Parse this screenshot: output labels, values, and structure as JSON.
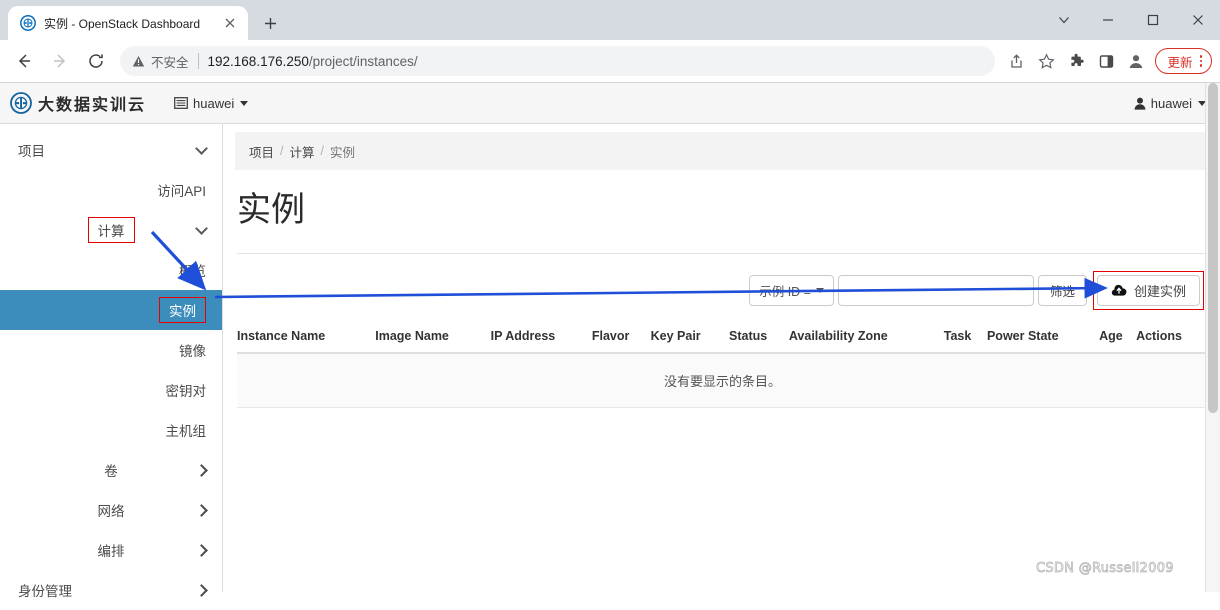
{
  "browser": {
    "tab": {
      "title": "实例 - OpenStack Dashboard",
      "favicon_name": "openstack-favicon",
      "close_label": "✕"
    },
    "newtab_label": "+",
    "window_controls": {
      "tab_search": "⌄",
      "minimize": "—",
      "maximize": "□",
      "close": "✕"
    },
    "nav": {
      "back": "←",
      "forward": "→",
      "reload": "⟳"
    },
    "omnibox": {
      "security_label": "不安全",
      "url_host": "192.168.176.250",
      "url_path": "/project/instances/",
      "url_full": "192.168.176.250/project/instances/"
    },
    "toolbar_icons": [
      {
        "name": "share-icon",
        "glyph": "⤴"
      },
      {
        "name": "bookmark-star-icon",
        "glyph": "☆"
      },
      {
        "name": "extensions-puzzle-icon",
        "glyph": "🧩"
      },
      {
        "name": "side-panel-icon",
        "glyph": "▢"
      },
      {
        "name": "profile-avatar-icon",
        "glyph": "●"
      }
    ],
    "update_button": {
      "label": "更新",
      "color": "#d93025"
    }
  },
  "app": {
    "brand": {
      "name": "大数据实训云",
      "logo_name": "openstack-logo"
    },
    "project_selector": {
      "label": "huawei",
      "icon_name": "project-grid-icon"
    },
    "user_menu": {
      "label": "huawei",
      "icon_name": "user-icon"
    },
    "sidebar": {
      "items": [
        {
          "label": "项目",
          "level": "top",
          "chevron": "down",
          "active": false
        },
        {
          "label": "访问API",
          "level": "sub",
          "chevron": "none",
          "active": false
        },
        {
          "label": "计算",
          "level": "group",
          "chevron": "down",
          "active": false,
          "annotated": true
        },
        {
          "label": "概览",
          "level": "sub",
          "chevron": "none",
          "active": false
        },
        {
          "label": "实例",
          "level": "sub",
          "chevron": "none",
          "active": true,
          "annotated": true
        },
        {
          "label": "镜像",
          "level": "sub",
          "chevron": "none",
          "active": false
        },
        {
          "label": "密钥对",
          "level": "sub",
          "chevron": "none",
          "active": false
        },
        {
          "label": "主机组",
          "level": "sub",
          "chevron": "none",
          "active": false
        },
        {
          "label": "卷",
          "level": "group",
          "chevron": "right",
          "active": false
        },
        {
          "label": "网络",
          "level": "group",
          "chevron": "right",
          "active": false
        },
        {
          "label": "编排",
          "level": "group",
          "chevron": "right",
          "active": false
        },
        {
          "label": "身份管理",
          "level": "top",
          "chevron": "right",
          "active": false
        }
      ]
    },
    "breadcrumb": {
      "items": [
        "项目",
        "计算",
        "实例"
      ],
      "separator": "/"
    },
    "page_title": "实例",
    "table_toolbar": {
      "filter_field_label": "示例 ID =",
      "filter_input_value": "",
      "filter_input_placeholder": "",
      "filter_button_label": "筛选",
      "launch_button_label": "创建实例",
      "launch_button_icon": "cloud-upload-icon"
    },
    "table": {
      "columns": [
        "Instance Name",
        "Image Name",
        "IP Address",
        "Flavor",
        "Key Pair",
        "Status",
        "Availability Zone",
        "Task",
        "Power State",
        "Age",
        "Actions"
      ],
      "rows": [],
      "empty_message": "没有要显示的条目。"
    },
    "colors": {
      "active_nav": "#3c8dbc",
      "annotation_box": "#e60000",
      "annotation_arrow": "#1f4fd8"
    }
  },
  "watermark": "CSDN @Russell2009"
}
